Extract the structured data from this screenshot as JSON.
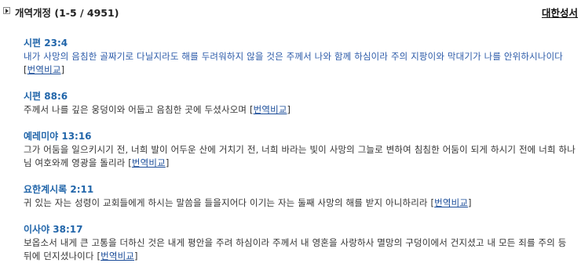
{
  "header": {
    "title": "개역개정 (1-5 / 4951)",
    "right_link": "대한성서"
  },
  "compare_open": "[",
  "compare_label": "번역비교",
  "compare_close": "]",
  "results": [
    {
      "reference": "시편 23:4",
      "text_segments": [
        {
          "t": "내가 사망의 음침한 골짜기로 다닐지라도 해를 두려워하지 않을 것은 ",
          "hl": true
        },
        {
          "t": "주께서 나와 함께 하심이라 주의 지팡이와 막대기가 나를 안위하시나이다",
          "hl": true
        }
      ]
    },
    {
      "reference": "시편 88:6",
      "text_segments": [
        {
          "t": "주께서 나를 깊은 웅덩이와 어둡고 음침한 곳에 두셨사오며",
          "hl": false
        }
      ]
    },
    {
      "reference": "예레미야 13:16",
      "text_segments": [
        {
          "t": "그가 어둠을 일으키시기 전, 너희 발이 어두운 산에 거치기 전, 너희 바라는 빛이 사망의 그늘로 변하여 침침한 어둠이 되게 하시기 전에 너희 하나님 여호와께 영광을 돌리라",
          "hl": false
        }
      ]
    },
    {
      "reference": "요한계시록 2:11",
      "text_segments": [
        {
          "t": "귀 있는 자는 성령이 교회들에게 하시는 말씀을 들을지어다 이기는 자는 둘째 사망의 해를 받지 아니하리라",
          "hl": false
        }
      ]
    },
    {
      "reference": "이사야 38:17",
      "text_segments": [
        {
          "t": "보옵소서 내게 큰 고통을 더하신 것은 내게 평안을 주려 하심이라 주께서 내 영혼을 사랑하사 멸망의 구덩이에서 건지셨고 내 모든 죄를 주의 등 뒤에 던지셨나이다",
          "hl": false
        }
      ]
    }
  ]
}
